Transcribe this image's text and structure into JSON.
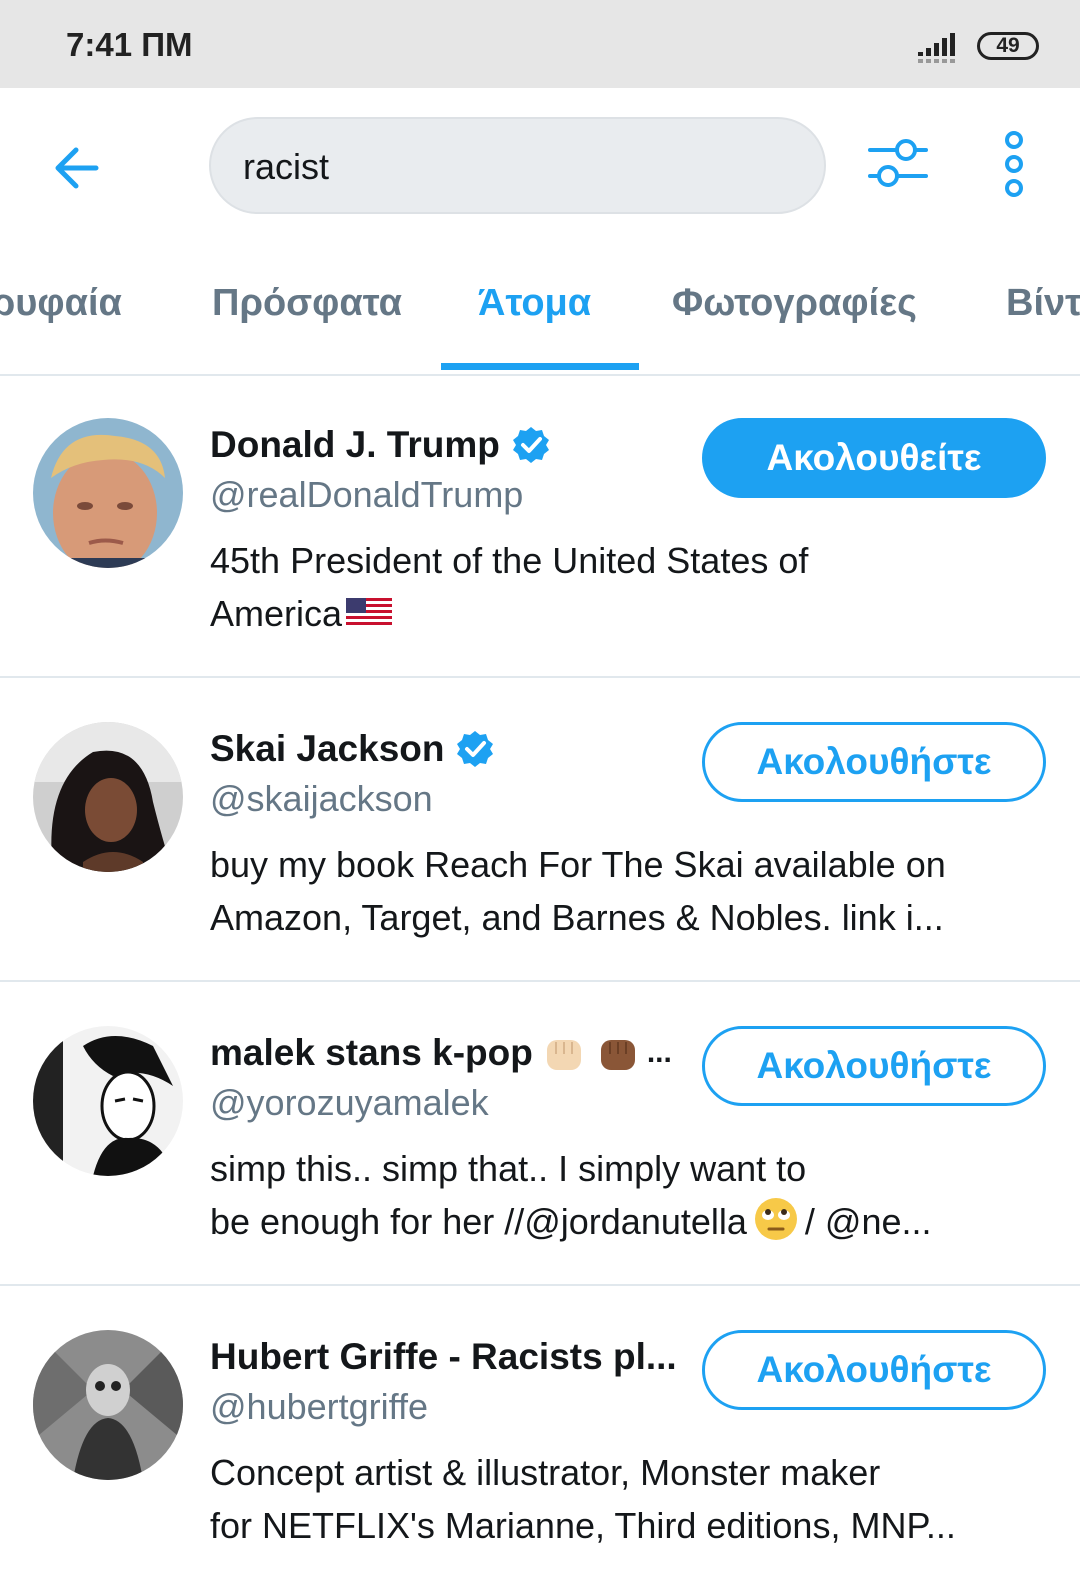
{
  "status_bar": {
    "time": "7:41 ΠΜ",
    "battery": "49"
  },
  "search": {
    "query": "racist"
  },
  "tabs": [
    {
      "label": "Κορυφαία"
    },
    {
      "label": "Πρόσφατα"
    },
    {
      "label": "Άτομα"
    },
    {
      "label": "Φωτογραφίες"
    },
    {
      "label": "Βίντεο"
    }
  ],
  "users": [
    {
      "name": "Donald J. Trump",
      "handle": "@realDonaldTrump",
      "bio_line1": "45th President of the United States of",
      "bio_line2": "America",
      "verified": true,
      "follow_label": "Ακολουθείτε"
    },
    {
      "name": "Skai Jackson",
      "handle": "@skaijackson",
      "bio_line1": "buy my book Reach For The Skai available on",
      "bio_line2": "Amazon, Target, and Barnes & Nobles. link i...",
      "verified": true,
      "follow_label": "Ακολουθήστε"
    },
    {
      "name": "malek stans k-pop",
      "name_suffix": "...",
      "handle": "@yorozuyamalek",
      "bio_line1": "simp this.. simp that.. I simply want to",
      "bio_line2a": "be enough for her //@jordanutella",
      "bio_line2b": "/ @ne...",
      "verified": false,
      "follow_label": "Ακολουθήστε"
    },
    {
      "name": "Hubert Griffe - Racists pl...",
      "handle": "@hubertgriffe",
      "bio_line1": "Concept artist & illustrator, Monster maker",
      "bio_line2": "for NETFLIX's Marianne, Third editions, MNP...",
      "verified": false,
      "follow_label": "Ακολουθήστε"
    }
  ],
  "colors": {
    "accent": "#1da1f2",
    "secondary_text": "#657786",
    "primary_text": "#14171a"
  }
}
